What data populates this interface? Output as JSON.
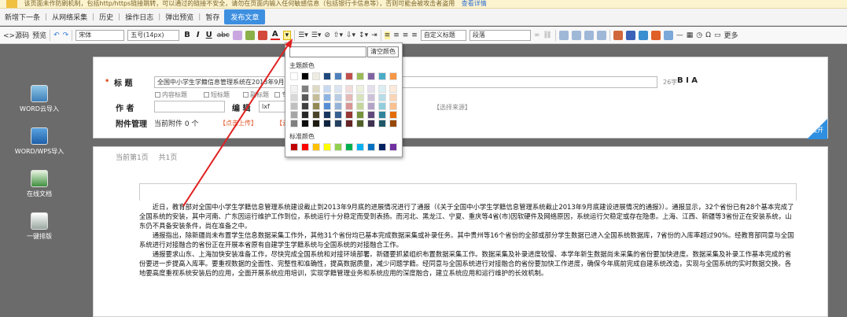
{
  "notice": {
    "text": "该页面未作防刷机制，包括http/https链接跳转，可以通过的链接不安全，请勿在页面内输入任何敏感信息（包括银行卡信息等），否则可能会被攻击者盗用",
    "link": "查看详情"
  },
  "topbar": {
    "items": [
      "新增下一条",
      "从网络采集",
      "历史",
      "操作日志",
      "弹出预览",
      "暂存"
    ],
    "publish": "发布文章"
  },
  "toolbar": {
    "source": "源码",
    "preview": "预览",
    "font_family": "宋体",
    "font_size": "五号(14px)",
    "bold": "B",
    "italic": "I",
    "underline": "U",
    "custom_title": "自定义标题",
    "paragraph": "段落",
    "more": "更多"
  },
  "sidebar": {
    "items": [
      {
        "label": "WORD云导入",
        "icon": "cloud-import-icon"
      },
      {
        "label": "WORD/WPS导入",
        "icon": "word-import-icon"
      },
      {
        "label": "在线文档",
        "icon": "online-doc-icon"
      },
      {
        "label": "一键排版",
        "icon": "auto-layout-icon"
      }
    ]
  },
  "form": {
    "title_label": "标  题",
    "title_value": "全国中小学生学籍信息管理系统在2013年9月底的建设进展情况",
    "title_counter": "26字",
    "title_format": "B I A",
    "options": [
      "内容标题",
      "短标题",
      "副标题",
      "专题"
    ],
    "author_label": "作  者",
    "editor_label": "编  辑",
    "editor_value": "lxf",
    "source_button": "【选择来源】",
    "attachment_label": "附件管理",
    "attachment_current": "当前附件 0 个",
    "upload_link": "【点击上传】",
    "cloud_link": "【云",
    "expand": "展开"
  },
  "page": {
    "current": "当前第1页",
    "total": "共1页"
  },
  "article": {
    "paragraphs": [
      "近日，教育部对全国中小学生学籍信息管理系统建设截止到2013年9月底的进展情况进行了通报（《关于全国中小学生学籍信息管理系统截止2013年9月底建设进展情况的通报》）。通报显示，32个省份已有28个基本完成了全国系统的安装，其中河南、广东因运行维护工作到位，系统运行十分稳定而受到表扬。而河北、黑龙江、宁夏、重庆等4省(市)因软硬件及网络原因，系统运行欠稳定或存在隐患。上海、江西、新疆等3省份正在安装系统，山东仍不具备安装条件，尚在准备之中。",
      "通报指出，除新疆尚未布置学生信息数据采集工作外，其他31个省份均已基本完成数据采集或补录任务。其中贵州等16个省份的全部或部分学生数据已进入全国系统数据库，7省份的入库率超过90%。经教育部同意与全国系统进行对接融合的省份正在开展本省原有自建学生学籍系统与全国系统的对接融合工作。",
      "通报要求山东、上海加快安装准备工作，尽快完成全国系统和对接环境部署。新疆要抓紧组织布置数据采集工作。数据采集及补录进度较慢、本学年新生数据尚未采集的省份要加快进度。数据采集及补录工作基本完成的省份要进一步提高入库率。要重视数据的全面性、完整性和准确性，提高数据质量，减少问题学籍。经同意与全国系统进行对接融合的省份要加快工作进度，确保今年底前完成自建系统改造，实现与全国系统的实时数据交换。各地要高度重视系统安装后的应用，全面开展系统应用培训，实现学籍管理业务和系统应用的深度融合，建立系统应用和运行维护的长效机制。"
    ]
  },
  "color_picker": {
    "clear_button": "清空颜色",
    "theme_label": "主题颜色",
    "standard_label": "标准颜色",
    "theme_top": [
      "#ffffff",
      "#000000",
      "#eeece1",
      "#1f497d",
      "#4f81bd",
      "#c0504d",
      "#9bbb59",
      "#8064a2",
      "#4bacc6",
      "#f79646"
    ],
    "theme_shades": [
      [
        "#f2f2f2",
        "#7f7f7f",
        "#ddd9c3",
        "#c6d9f0",
        "#dbe5f1",
        "#f2dcdb",
        "#ebf1dd",
        "#e5e0ec",
        "#dbeef3",
        "#fdeada"
      ],
      [
        "#d8d8d8",
        "#595959",
        "#c4bd97",
        "#8db3e2",
        "#b8cce4",
        "#e5b9b7",
        "#d7e3bc",
        "#ccc1d9",
        "#b7dde8",
        "#fbd5b5"
      ],
      [
        "#bfbfbf",
        "#3f3f3f",
        "#938953",
        "#548dd4",
        "#95b3d7",
        "#d99694",
        "#c3d69b",
        "#b2a2c7",
        "#92cddc",
        "#fac08f"
      ],
      [
        "#a5a5a5",
        "#262626",
        "#494429",
        "#17365d",
        "#366092",
        "#953734",
        "#76923c",
        "#5f497a",
        "#31859b",
        "#e36c09"
      ],
      [
        "#7f7f7f",
        "#0c0c0c",
        "#1d1b10",
        "#0f243e",
        "#244061",
        "#632423",
        "#4f6128",
        "#3f3151",
        "#205867",
        "#974806"
      ]
    ],
    "standard": [
      "#c00000",
      "#ff0000",
      "#ffc000",
      "#ffff00",
      "#92d050",
      "#00b050",
      "#00b0f0",
      "#0070c0",
      "#002060",
      "#7030a0"
    ]
  },
  "colors": {
    "accent": "#3d8fe0",
    "link_red": "#e05a2b",
    "arrow": "#e02020"
  }
}
